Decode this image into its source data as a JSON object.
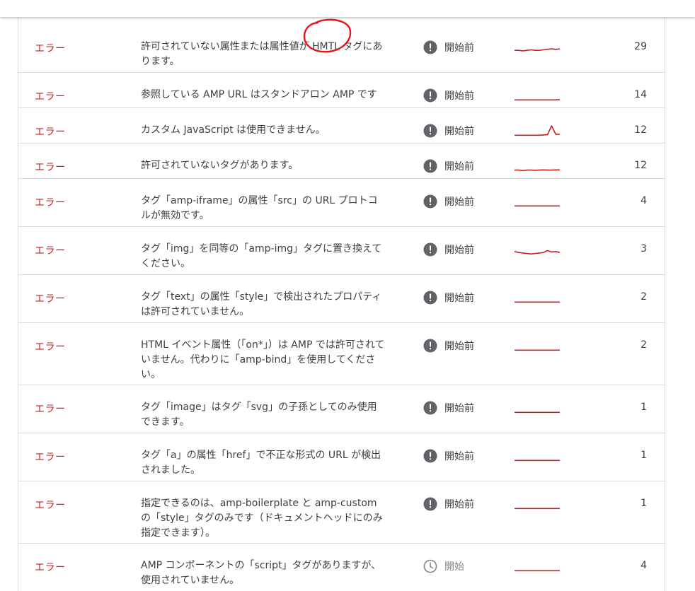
{
  "colors": {
    "error_red": "#c5221f",
    "text": "#3c4043",
    "icon_dark": "#5f6368",
    "pending_grey": "#80868b",
    "divider": "#dadce0",
    "sparkline": "#c5221f",
    "annotation": "#e8141c"
  },
  "rows": [
    {
      "type": "エラー",
      "description": "許可されていない属性または属性値が HMTL タグにあります。",
      "status_label": "開始前",
      "status_icon": "exclamation-circle-icon",
      "trend": [
        0.2,
        0.2,
        0.15,
        0.2,
        0.25,
        0.2,
        0.2,
        0.25,
        0.3,
        0.35,
        0.3,
        0.35
      ],
      "count": "29"
    },
    {
      "type": "エラー",
      "description": "参照している AMP URL はスタンドアロン AMP です",
      "status_label": "開始前",
      "status_icon": "exclamation-circle-icon",
      "trend": [
        0.05,
        0.05,
        0.05,
        0.05,
        0.05,
        0.05,
        0.05,
        0.05,
        0.05,
        0.05,
        0.05,
        0.08
      ],
      "count": "14"
    },
    {
      "type": "エラー",
      "description": "カスタム JavaScript は使用できません。",
      "status_label": "開始前",
      "status_icon": "exclamation-circle-icon",
      "trend": [
        0.05,
        0.05,
        0.05,
        0.05,
        0.05,
        0.05,
        0.05,
        0.08,
        0.1,
        1.0,
        0.15,
        0.15
      ],
      "count": "12"
    },
    {
      "type": "エラー",
      "description": "許可されていないタグがあります。",
      "status_label": "開始前",
      "status_icon": "exclamation-circle-icon",
      "trend": [
        0.1,
        0.1,
        0.05,
        0.1,
        0.1,
        0.08,
        0.1,
        0.12,
        0.1,
        0.1,
        0.12,
        0.12
      ],
      "count": "12"
    },
    {
      "type": "エラー",
      "description": "タグ「amp-iframe」の属性「src」の URL プロトコルが無効です。",
      "status_label": "開始前",
      "status_icon": "exclamation-circle-icon",
      "trend": [
        0.05,
        0.05,
        0.05,
        0.05,
        0.05,
        0.05,
        0.05,
        0.05,
        0.05,
        0.05,
        0.05,
        0.05
      ],
      "count": "4"
    },
    {
      "type": "エラー",
      "description": "タグ「img」を同等の「amp-img」タグに置き換えてください。",
      "status_label": "開始前",
      "status_icon": "exclamation-circle-icon",
      "trend": [
        0.3,
        0.2,
        0.15,
        0.1,
        0.05,
        0.1,
        0.15,
        0.2,
        0.4,
        0.25,
        0.3,
        0.2
      ],
      "count": "3"
    },
    {
      "type": "エラー",
      "description": "タグ「text」の属性「style」で検出されたプロパティは許可されていません。",
      "status_label": "開始前",
      "status_icon": "exclamation-circle-icon",
      "trend": [
        0.05,
        0.05,
        0.05,
        0.05,
        0.05,
        0.05,
        0.05,
        0.05,
        0.05,
        0.05,
        0.05,
        0.05
      ],
      "count": "2"
    },
    {
      "type": "エラー",
      "description": "HTML イベント属性（「on*」）は AMP では許可されていません。代わりに「amp-bind」を使用してください。",
      "status_label": "開始前",
      "status_icon": "exclamation-circle-icon",
      "trend": [
        0.05,
        0.05,
        0.05,
        0.05,
        0.05,
        0.05,
        0.05,
        0.05,
        0.05,
        0.05,
        0.05,
        0.05
      ],
      "count": "2"
    },
    {
      "type": "エラー",
      "description": "タグ「image」はタグ「svg」の子孫としてのみ使用できます。",
      "status_label": "開始前",
      "status_icon": "exclamation-circle-icon",
      "trend": [
        0.05,
        0.05,
        0.05,
        0.05,
        0.05,
        0.05,
        0.05,
        0.05,
        0.05,
        0.05,
        0.05,
        0.05
      ],
      "count": "1"
    },
    {
      "type": "エラー",
      "description": "タグ「a」の属性「href」で不正な形式の URL が検出されました。",
      "status_label": "開始前",
      "status_icon": "exclamation-circle-icon",
      "trend": [
        0.05,
        0.05,
        0.05,
        0.05,
        0.05,
        0.05,
        0.05,
        0.05,
        0.05,
        0.05,
        0.05,
        0.05
      ],
      "count": "1"
    },
    {
      "type": "エラー",
      "description": "指定できるのは、amp-boilerplate と amp-custom の「style」タグのみです（ドキュメントヘッドにのみ指定できます）。",
      "status_label": "開始前",
      "status_icon": "exclamation-circle-icon",
      "trend": [
        0.05,
        0.05,
        0.05,
        0.05,
        0.05,
        0.05,
        0.05,
        0.05,
        0.05,
        0.05,
        0.05,
        0.05
      ],
      "count": "1"
    },
    {
      "type": "エラー",
      "description": "AMP コンポーネントの「script」タグがありますが、使用されていません。",
      "status_label": "開始",
      "status_icon": "clock-icon",
      "trend": [
        0.05,
        0.05,
        0.05,
        0.05,
        0.05,
        0.05,
        0.05,
        0.05,
        0.05,
        0.05,
        0.05,
        0.05
      ],
      "count": "4"
    }
  ]
}
